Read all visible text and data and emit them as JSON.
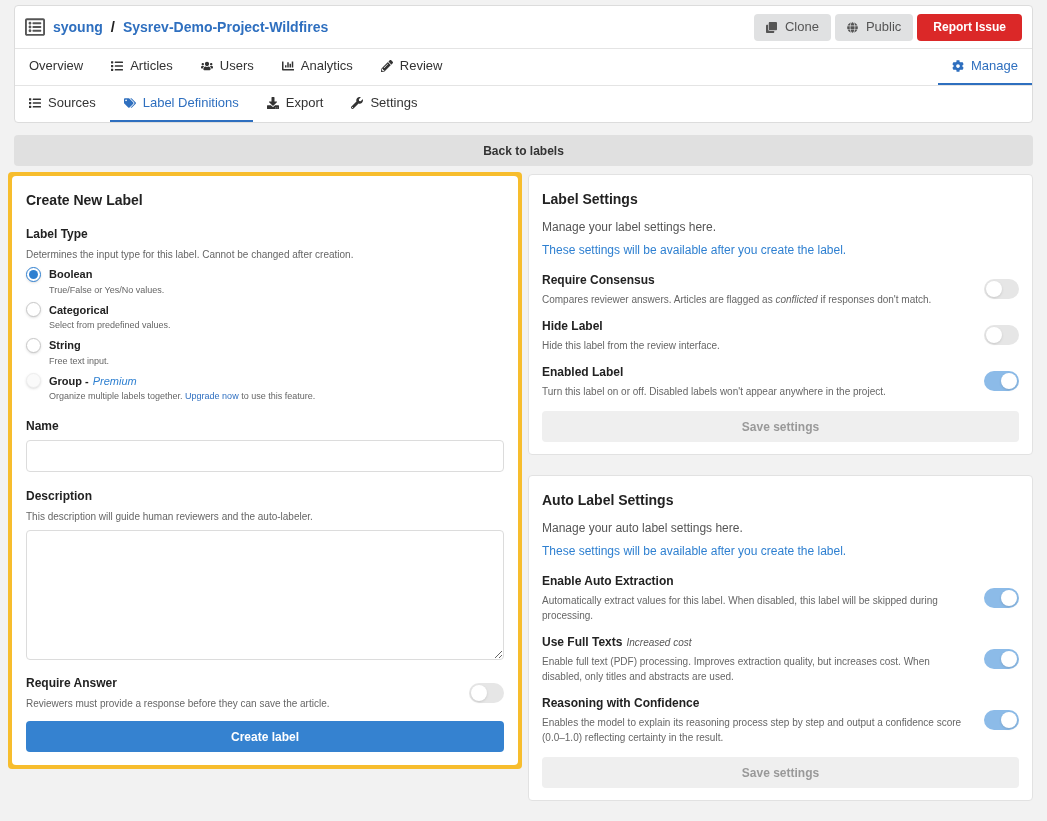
{
  "header": {
    "owner": "syoung",
    "separator": "/",
    "project": "Sysrev-Demo-Project-Wildfires",
    "buttons": [
      {
        "label": "Clone",
        "kind": "clone"
      },
      {
        "label": "Public",
        "kind": "public"
      },
      {
        "label": "Report Issue",
        "kind": "report"
      }
    ]
  },
  "nav": {
    "tabs": [
      {
        "label": "Overview",
        "kind": "plain",
        "selected": false
      },
      {
        "label": "Articles",
        "kind": "list",
        "selected": false
      },
      {
        "label": "Users",
        "kind": "users",
        "selected": false
      },
      {
        "label": "Analytics",
        "kind": "chart",
        "selected": false
      },
      {
        "label": "Review",
        "kind": "pencil",
        "selected": false
      },
      {
        "label": "Manage",
        "kind": "gear",
        "selected": true
      }
    ]
  },
  "subnav": {
    "tabs": [
      {
        "label": "Sources",
        "kind": "list",
        "selected": false
      },
      {
        "label": "Label Definitions",
        "kind": "tags",
        "selected": true
      },
      {
        "label": "Export",
        "kind": "download",
        "selected": false
      },
      {
        "label": "Settings",
        "kind": "wrench",
        "selected": false
      }
    ]
  },
  "back_button": "Back to labels",
  "create_form": {
    "title": "Create New Label",
    "highlighted": true,
    "label_type": {
      "label": "Label Type",
      "hint": "Determines the input type for this label. Cannot be changed after creation.",
      "options": [
        {
          "label": "Boolean",
          "description": "True/False or Yes/No values.",
          "selected": true,
          "disabled": false
        },
        {
          "label": "Categorical",
          "description": "Select from predefined values.",
          "selected": false,
          "disabled": false
        },
        {
          "label": "String",
          "description": "Free text input.",
          "selected": false,
          "disabled": false
        },
        {
          "label": "Group -",
          "tag": "Premium",
          "description": "Organize multiple labels together.",
          "link": "Upgrade now",
          "description_after": "to use this feature.",
          "selected": false,
          "disabled": true
        }
      ]
    },
    "name": {
      "label": "Name"
    },
    "description": {
      "label": "Description",
      "hint": "This description will guide human reviewers and the auto-labeler."
    },
    "require_answer": {
      "label": "Require Answer",
      "description": "Reviewers must provide a response before they can save the article.",
      "on": false
    },
    "submit": "Create label"
  },
  "panels": [
    {
      "title": "Label Settings",
      "subtitle": "Manage your label settings here.",
      "notice": "These settings will be available after you create the label.",
      "settings": [
        {
          "label": "Require Consensus",
          "description": "Compares reviewer answers. Articles are flagged as *conflicted* if responses don't match.",
          "on": false
        },
        {
          "label": "Hide Label",
          "description": "Hide this label from the review interface.",
          "on": false
        },
        {
          "label": "Enabled Label",
          "description": "Turn this label on or off. Disabled labels won't appear anywhere in the project.",
          "on": true
        }
      ],
      "save_button": "Save settings"
    },
    {
      "title": "Auto Label Settings",
      "subtitle": "Manage your auto label settings here.",
      "notice": "These settings will be available after you create the label.",
      "settings": [
        {
          "label": "Enable Auto Extraction",
          "description": "Automatically extract values for this label. When disabled, this label will be skipped during processing.",
          "on": true
        },
        {
          "label": "Use Full Texts",
          "tag": "Increased cost",
          "description": "Enable full text (PDF) processing. Improves extraction quality, but increases cost. When disabled, only titles and abstracts are used.",
          "on": true
        },
        {
          "label": "Reasoning with Confidence",
          "description": "Enables the model to explain its reasoning process step by step and output a confidence score (0.0–1.0) reflecting certainty in the result.",
          "on": true
        }
      ],
      "save_button": "Save settings"
    }
  ]
}
